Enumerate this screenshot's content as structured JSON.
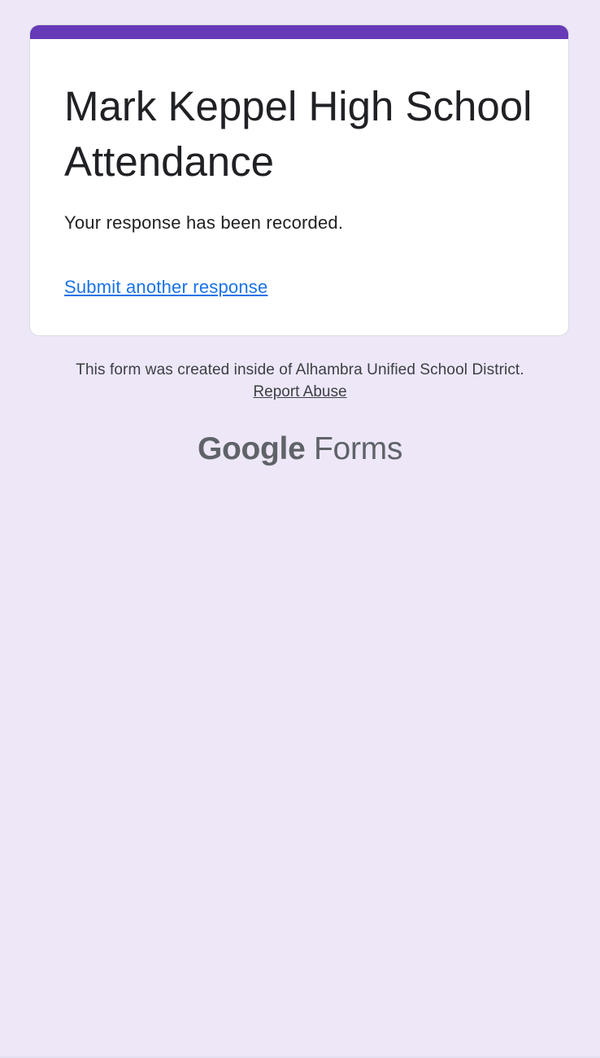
{
  "form": {
    "title": "Mark Keppel High School Attendance",
    "confirmation": "Your response has been recorded.",
    "submit_another": "Submit another response"
  },
  "footer": {
    "note": "This form was created inside of Alhambra Unified School District.",
    "report_abuse": "Report Abuse"
  },
  "branding": {
    "google": "Google",
    "forms": "Forms"
  },
  "colors": {
    "background": "#ede7f8",
    "accent": "#673ab7",
    "link": "#1a73e8",
    "text": "#202124"
  }
}
